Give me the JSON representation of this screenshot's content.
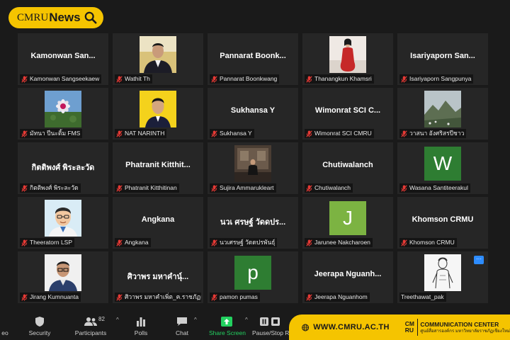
{
  "logo": {
    "cmru": "CMRU",
    "news": "News"
  },
  "tiles": [
    {
      "display": "Kamonwan San...",
      "label": "Kamonwan Sangseekaew",
      "kind": "name"
    },
    {
      "display": "",
      "label": "Wathit Th",
      "kind": "photo",
      "photo": "man-suit-yellow-bg"
    },
    {
      "display": "Pannarat  Boonk...",
      "label": "Pannarat Boonkwang",
      "kind": "name"
    },
    {
      "display": "",
      "label": "Thanangkun Khamsri",
      "kind": "photo",
      "photo": "woman-red-dress"
    },
    {
      "display": "Isariyaporn  San...",
      "label": "Isariyaporn Sangpunya",
      "kind": "name"
    },
    {
      "display": "",
      "label": "มัทนา ปีนะติ้ม FMS",
      "kind": "photo",
      "photo": "flower"
    },
    {
      "display": "",
      "label": "NAT NARINTH",
      "kind": "photo",
      "photo": "man-yellow-bg"
    },
    {
      "display": "Sukhansa Y",
      "label": "Sukhansa Y",
      "kind": "name"
    },
    {
      "display": "Wimonrat SCI C...",
      "label": "Wimonrat SCI CMRU",
      "kind": "name"
    },
    {
      "display": "",
      "label": "วาสนา อังศริสรปีชาว",
      "kind": "photo",
      "photo": "mountain-landscape"
    },
    {
      "display": "กิตติพงศ์ พิระละวัด",
      "label": "กิตติพงศ์ พิระละวัด",
      "kind": "name"
    },
    {
      "display": "Phatranit  Kitthit...",
      "label": "Phatranit Kitthitinan",
      "kind": "name"
    },
    {
      "display": "",
      "label": "Sujira Ammarukleart",
      "kind": "photo",
      "photo": "person-in-room"
    },
    {
      "display": "Chutiwalanch",
      "label": "Chutiwalanch",
      "kind": "name"
    },
    {
      "display": "W",
      "label": "Wasana Santiteerakul",
      "kind": "initial",
      "color": "#2e7d32"
    },
    {
      "display": "",
      "label": "Theeratorn LSP",
      "kind": "photo",
      "photo": "cartoon-man"
    },
    {
      "display": "Angkana",
      "label": "Angkana",
      "kind": "name"
    },
    {
      "display": "นวเ ศรษฐ์ วัดดปร...",
      "label": "นวเศรษฐ์ วัดดปรพันธุ์",
      "kind": "name"
    },
    {
      "display": "J",
      "label": "Jarunee Nakcharoen",
      "kind": "initial",
      "color": "#7cb342"
    },
    {
      "display": "Khomson CRMU",
      "label": "Khomson CRMU",
      "kind": "name"
    },
    {
      "display": "",
      "label": "Jirang Kumnuanta",
      "kind": "photo",
      "photo": "man-glasses"
    },
    {
      "display": "ศิวาพร มหาคำนุ์...",
      "label": "ศิวาพร มหาคำเพิ่ต_ค.ราชภัฏเ...",
      "kind": "name"
    },
    {
      "display": "p",
      "label": "pamon pumas",
      "kind": "initial",
      "color": "#2e7d32"
    },
    {
      "display": "Jeerapa  Nguanh...",
      "label": "Jeerapa Nguanhom",
      "kind": "name"
    },
    {
      "display": "",
      "label": "Treethawat_pak",
      "kind": "photo",
      "photo": "sketch-figure",
      "noMic": true
    }
  ],
  "toolbar": {
    "video_partial": "eo",
    "security": "Security",
    "participants": "Participants",
    "participants_count": "82",
    "polls": "Polls",
    "chat": "Chat",
    "share_screen": "Share Screen",
    "pause_stop": "Pause/Stop R",
    "accent_green": "#23d160"
  },
  "brand": {
    "url": "WWW.CMRU.AC.TH",
    "mark_top": "CM",
    "mark_bottom": "RU",
    "title": "COMMUNICATION CENTER",
    "subtitle": "ศูนย์สื่อสารองค์กร มหาวิทยาลัยราชภัฏเชียงใหม่"
  }
}
